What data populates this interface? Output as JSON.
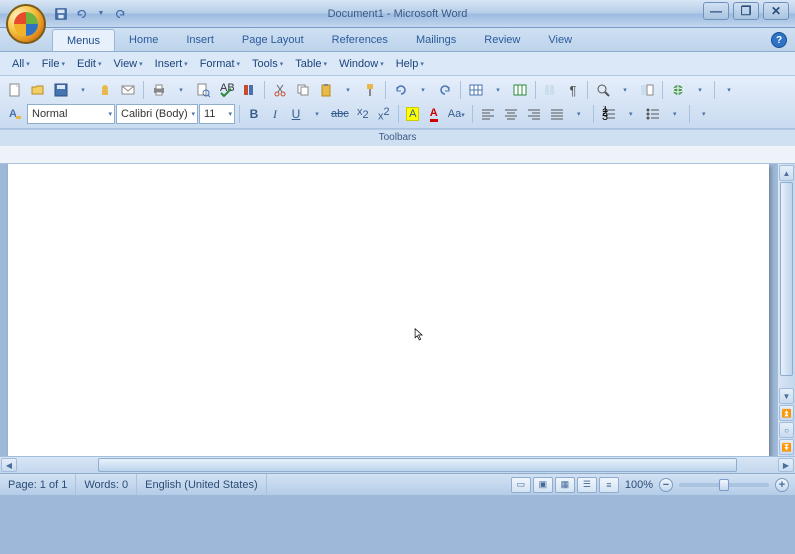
{
  "title": "Document1 - Microsoft Word",
  "qat": {
    "save": "save-icon",
    "undo": "undo-icon",
    "redo": "redo-icon"
  },
  "tabs": [
    {
      "label": "Menus",
      "active": true
    },
    {
      "label": "Home",
      "active": false
    },
    {
      "label": "Insert",
      "active": false
    },
    {
      "label": "Page Layout",
      "active": false
    },
    {
      "label": "References",
      "active": false
    },
    {
      "label": "Mailings",
      "active": false
    },
    {
      "label": "Review",
      "active": false
    },
    {
      "label": "View",
      "active": false
    }
  ],
  "menus": [
    "All",
    "File",
    "Edit",
    "View",
    "Insert",
    "Format",
    "Tools",
    "Table",
    "Window",
    "Help"
  ],
  "format": {
    "style": "Normal",
    "font": "Calibri (Body)",
    "size": "11"
  },
  "toolbar_group_label": "Toolbars",
  "status": {
    "page": "Page: 1 of 1",
    "words": "Words: 0",
    "lang": "English (United States)",
    "zoom": "100%"
  }
}
